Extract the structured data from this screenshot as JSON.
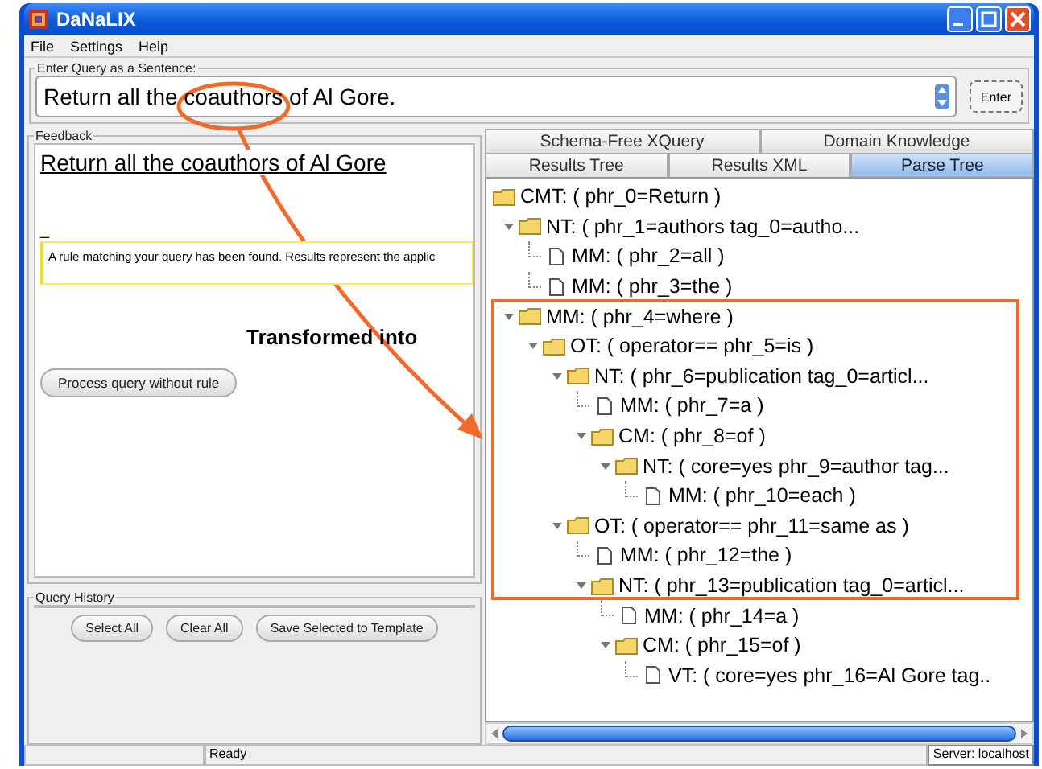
{
  "window": {
    "title": "DaNaLIX"
  },
  "menu": [
    "File",
    "Settings",
    "Help"
  ],
  "query": {
    "label": "Enter Query as a Sentence:",
    "value": "Return all the coauthors of Al Gore.",
    "button": "Enter"
  },
  "feedback": {
    "title": "Feedback",
    "heading": "Return all the coauthors of Al Gore",
    "mark": "_",
    "message": "A rule matching your query has been found. Results represent the applic",
    "button": "Process query without rule"
  },
  "history": {
    "title": "Query History",
    "buttons": [
      "Select All",
      "Clear All",
      "Save Selected to Template"
    ]
  },
  "tab_rows": [
    [
      {
        "label": "Schema-Free XQuery",
        "selected": false
      },
      {
        "label": "Domain Knowledge",
        "selected": false
      }
    ],
    [
      {
        "label": "Results Tree",
        "selected": false
      },
      {
        "label": "Results XML",
        "selected": false
      },
      {
        "label": "Parse Tree",
        "selected": true
      }
    ]
  ],
  "tree": [
    {
      "kind": "folder",
      "label": "CMT: ( phr_0=Return )",
      "children": [
        {
          "kind": "folder",
          "label": "NT: ( phr_1=authors tag_0=autho...",
          "children": [
            {
              "kind": "file",
              "label": "MM: ( phr_2=all )"
            },
            {
              "kind": "file",
              "label": "MM: ( phr_3=the )"
            }
          ]
        },
        {
          "kind": "folder",
          "label": "MM: ( phr_4=where )",
          "children": [
            {
              "kind": "folder",
              "label": "OT: ( operator== phr_5=is )",
              "children": [
                {
                  "kind": "folder",
                  "label": "NT: ( phr_6=publication tag_0=articl...",
                  "children": [
                    {
                      "kind": "file",
                      "label": "MM: ( phr_7=a )"
                    },
                    {
                      "kind": "folder",
                      "label": "CM: ( phr_8=of )",
                      "children": [
                        {
                          "kind": "folder",
                          "label": "NT: ( core=yes phr_9=author tag...",
                          "children": [
                            {
                              "kind": "file",
                              "label": "MM: ( phr_10=each )"
                            }
                          ]
                        }
                      ]
                    }
                  ]
                },
                {
                  "kind": "folder",
                  "label": "OT: ( operator== phr_11=same as )",
                  "children": [
                    {
                      "kind": "file",
                      "label": "MM: ( phr_12=the )"
                    },
                    {
                      "kind": "folder",
                      "label": "NT: ( phr_13=publication tag_0=articl...",
                      "children": [
                        {
                          "kind": "file",
                          "label": "MM: ( phr_14=a )"
                        },
                        {
                          "kind": "folder",
                          "label": "CM: ( phr_15=of )",
                          "children": [
                            {
                              "kind": "file",
                              "label": "VT: ( core=yes phr_16=Al Gore tag.."
                            }
                          ]
                        }
                      ]
                    }
                  ]
                }
              ]
            }
          ]
        }
      ]
    }
  ],
  "annotation": {
    "text": "Transformed into"
  },
  "status_bar": {
    "message": "Ready",
    "server": "Server: localhost"
  }
}
